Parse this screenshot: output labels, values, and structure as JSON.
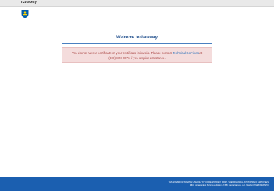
{
  "app": {
    "title": "Gateway"
  },
  "logo": {
    "icon": "rbc-shield-logo",
    "colors": {
      "blue": "#005daa",
      "yellow": "#ffd200"
    }
  },
  "main": {
    "heading": "Welcome to Gateway",
    "alert": {
      "text_before": "You do not have a certificate or your certificate is invalid. Please contact ",
      "link": "Technical Services",
      "text_after_line1": " at",
      "text_line2": "(800) 820-0276 if you require assistance."
    }
  },
  "footer": {
    "line1": "THIS SITE IS FOR INTERNAL USE ONLY BY CORRESPONDENT FIRMS, THEIR FINANCIAL ADVISORS AND EMPLOYEES",
    "line2": "RBC Correspondent Services, a division of RBC Capital Markets, LLC, Member NYSE/FINRA/SIPC"
  },
  "colors": {
    "topbar": "#e9e9e9",
    "heading": "#1f4e8c",
    "alert_bg": "#f4dcdc",
    "alert_text": "#a94442",
    "link": "#2a6fb8",
    "footer": "#1b5fb0"
  }
}
